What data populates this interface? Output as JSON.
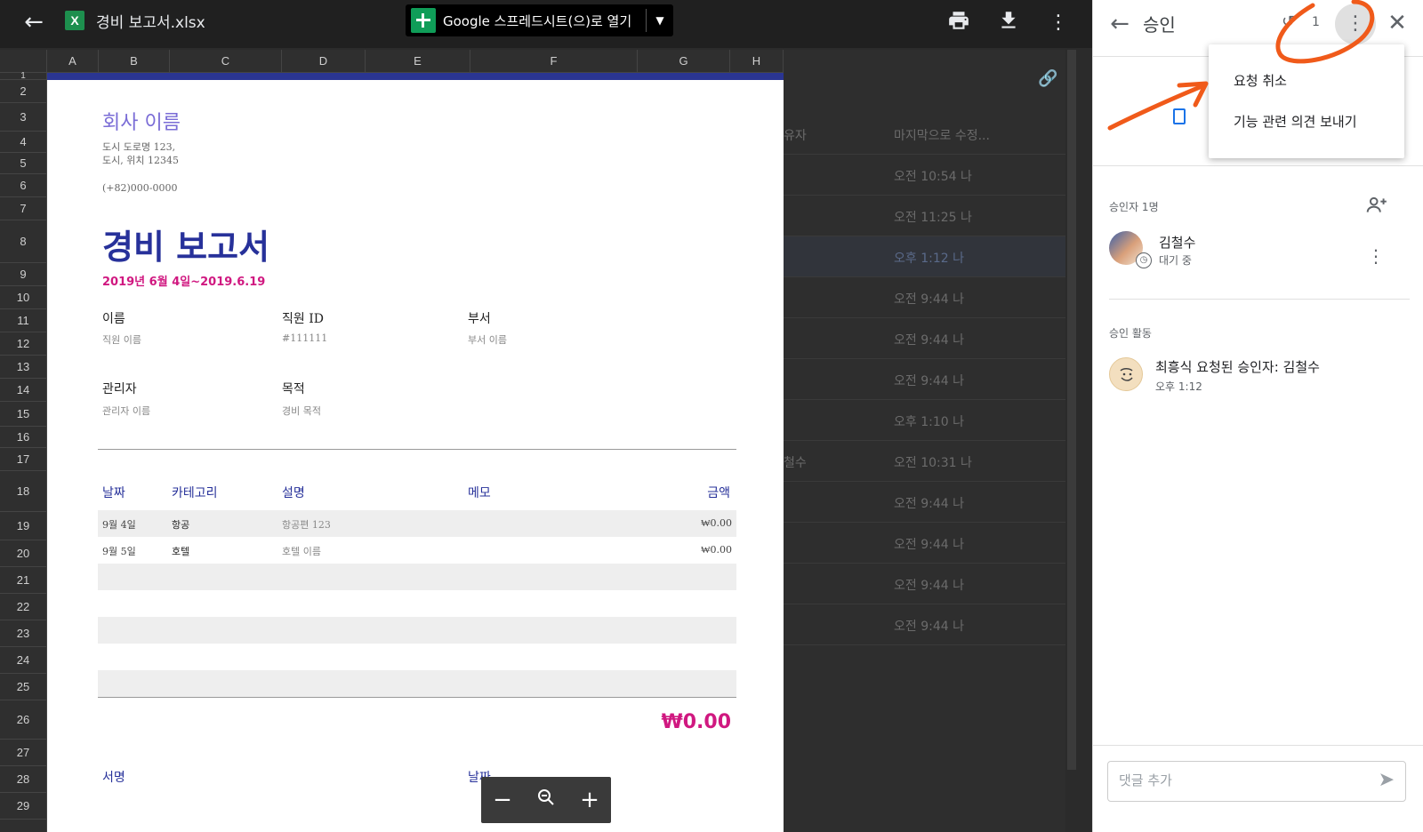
{
  "topbar": {
    "file_title": "경비 보고서.xlsx",
    "open_with_label": "Google 스프레드시트(으)로 열기",
    "icons": [
      "back-arrow-icon",
      "excel-file-icon",
      "google-sheets-icon",
      "caret-down-icon",
      "print-icon",
      "download-icon",
      "more-vert-icon"
    ]
  },
  "sheet": {
    "columns": [
      "A",
      "B",
      "C",
      "D",
      "E",
      "F",
      "G",
      "H"
    ],
    "rows": [
      "1",
      "2",
      "3",
      "4",
      "5",
      "6",
      "7",
      "8",
      "9",
      "10",
      "11",
      "12",
      "13",
      "14",
      "15",
      "16",
      "17",
      "18",
      "19",
      "20",
      "21",
      "22",
      "23",
      "24",
      "25",
      "26",
      "27",
      "28",
      "29"
    ]
  },
  "background_list": {
    "header": {
      "owner": "유자",
      "modified": "마지막으로 수정..."
    },
    "rows": [
      {
        "owner": "",
        "modified": "오전 10:54 나"
      },
      {
        "owner": "",
        "modified": "오전 11:25 나"
      },
      {
        "owner": "",
        "modified": "오후 1:12 나"
      },
      {
        "owner": "",
        "modified": "오전 9:44 나"
      },
      {
        "owner": "",
        "modified": "오전 9:44 나"
      },
      {
        "owner": "",
        "modified": "오전 9:44 나"
      },
      {
        "owner": "",
        "modified": "오후 1:10 나"
      },
      {
        "owner": "철수",
        "modified": "오전 10:31 나"
      },
      {
        "owner": "",
        "modified": "오전 9:44 나"
      },
      {
        "owner": "",
        "modified": "오전 9:44 나"
      },
      {
        "owner": "",
        "modified": "오전 9:44 나"
      },
      {
        "owner": "",
        "modified": "오전 9:44 나"
      }
    ]
  },
  "document": {
    "company_name": "회사 이름",
    "address_line1": "도시 도로명 123,",
    "address_line2": "도시, 위치 12345",
    "phone": "(+82)000-0000",
    "title": "경비 보고서",
    "date_range": "2019년 6월 4일~2019.6.19",
    "fields": {
      "name_label": "이름",
      "name_value": "직원 이름",
      "id_label": "직원 ID",
      "id_value": "#111111",
      "dept_label": "부서",
      "dept_value": "부서 이름",
      "manager_label": "관리자",
      "manager_value": "관리자 이름",
      "purpose_label": "목적",
      "purpose_value": "경비 목적"
    },
    "table_headers": {
      "date": "날짜",
      "category": "카테고리",
      "description": "설명",
      "memo": "메모",
      "amount": "금액"
    },
    "table_rows": [
      {
        "date": "9월 4일",
        "category": "항공",
        "description": "항공편 123",
        "memo": "",
        "amount": "₩0.00"
      },
      {
        "date": "9월 5일",
        "category": "호텔",
        "description": "호텔 이름",
        "memo": "",
        "amount": "₩0.00"
      }
    ],
    "total": "₩0.00",
    "signature_label": "서명",
    "date_label": "날짜"
  },
  "zoom_bar": {
    "icons": [
      "zoom-out-icon",
      "zoom-icon",
      "zoom-in-icon"
    ]
  },
  "panel": {
    "title": "승인",
    "history_count": "1",
    "menu": {
      "cancel_request": "요청 취소",
      "send_feedback": "기능 관련 의견 보내기"
    },
    "approvers_label": "승인자 1명",
    "approver": {
      "name": "김철수",
      "status": "대기 중"
    },
    "activity_label": "승인 활동",
    "activity": {
      "text": "최흥식 요청된 승인자: 김철수",
      "time": "오후 1:12"
    },
    "comment_placeholder": "댓글 추가"
  },
  "colors": {
    "accent_title": "#27319a",
    "accent_pink": "#d01880",
    "annotation": "#f05a1a",
    "sheets_green": "#0f9d58"
  }
}
